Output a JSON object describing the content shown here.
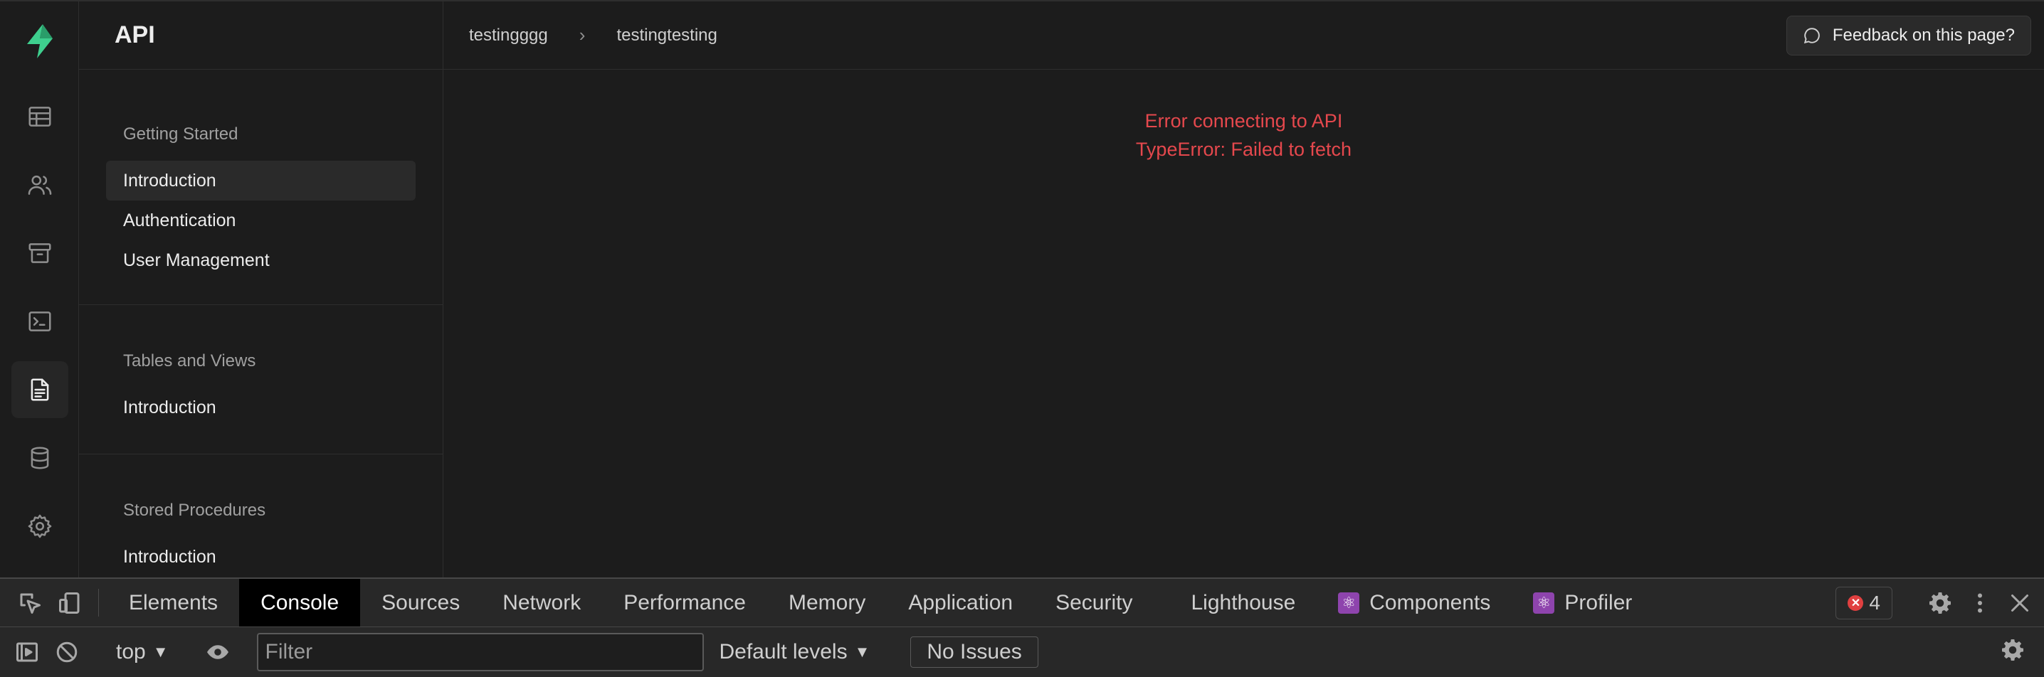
{
  "app": {
    "panel_title": "API",
    "rail_icons": [
      "bolt-logo-icon",
      "table-editor-icon",
      "users-icon",
      "archive-icon",
      "terminal-icon",
      "document-icon",
      "database-icon",
      "settings-icon"
    ]
  },
  "sidebar": {
    "sections": [
      {
        "heading": "Getting Started",
        "items": [
          "Introduction",
          "Authentication",
          "User Management"
        ]
      },
      {
        "heading": "Tables and Views",
        "items": [
          "Introduction"
        ]
      },
      {
        "heading": "Stored Procedures",
        "items": [
          "Introduction"
        ]
      }
    ]
  },
  "breadcrumb": {
    "project": "testingggg",
    "page": "testingtesting",
    "separator": "›"
  },
  "feedback": {
    "label": "Feedback on this page?"
  },
  "error": {
    "line1": "Error connecting to API",
    "line2": "TypeError: Failed to fetch",
    "color": "#e5484d"
  },
  "devtools": {
    "tabs": [
      "Elements",
      "Console",
      "Sources",
      "Network",
      "Performance",
      "Memory",
      "Application",
      "Security",
      "Lighthouse",
      "Components",
      "Profiler"
    ],
    "active_tab": "Console",
    "error_count": "4",
    "context": "top",
    "filter_placeholder": "Filter",
    "levels": "Default levels",
    "issues": "No Issues"
  },
  "colors": {
    "brand": "#3ecf8e",
    "background": "#1c1c1c",
    "devtools_bg": "#282828"
  }
}
